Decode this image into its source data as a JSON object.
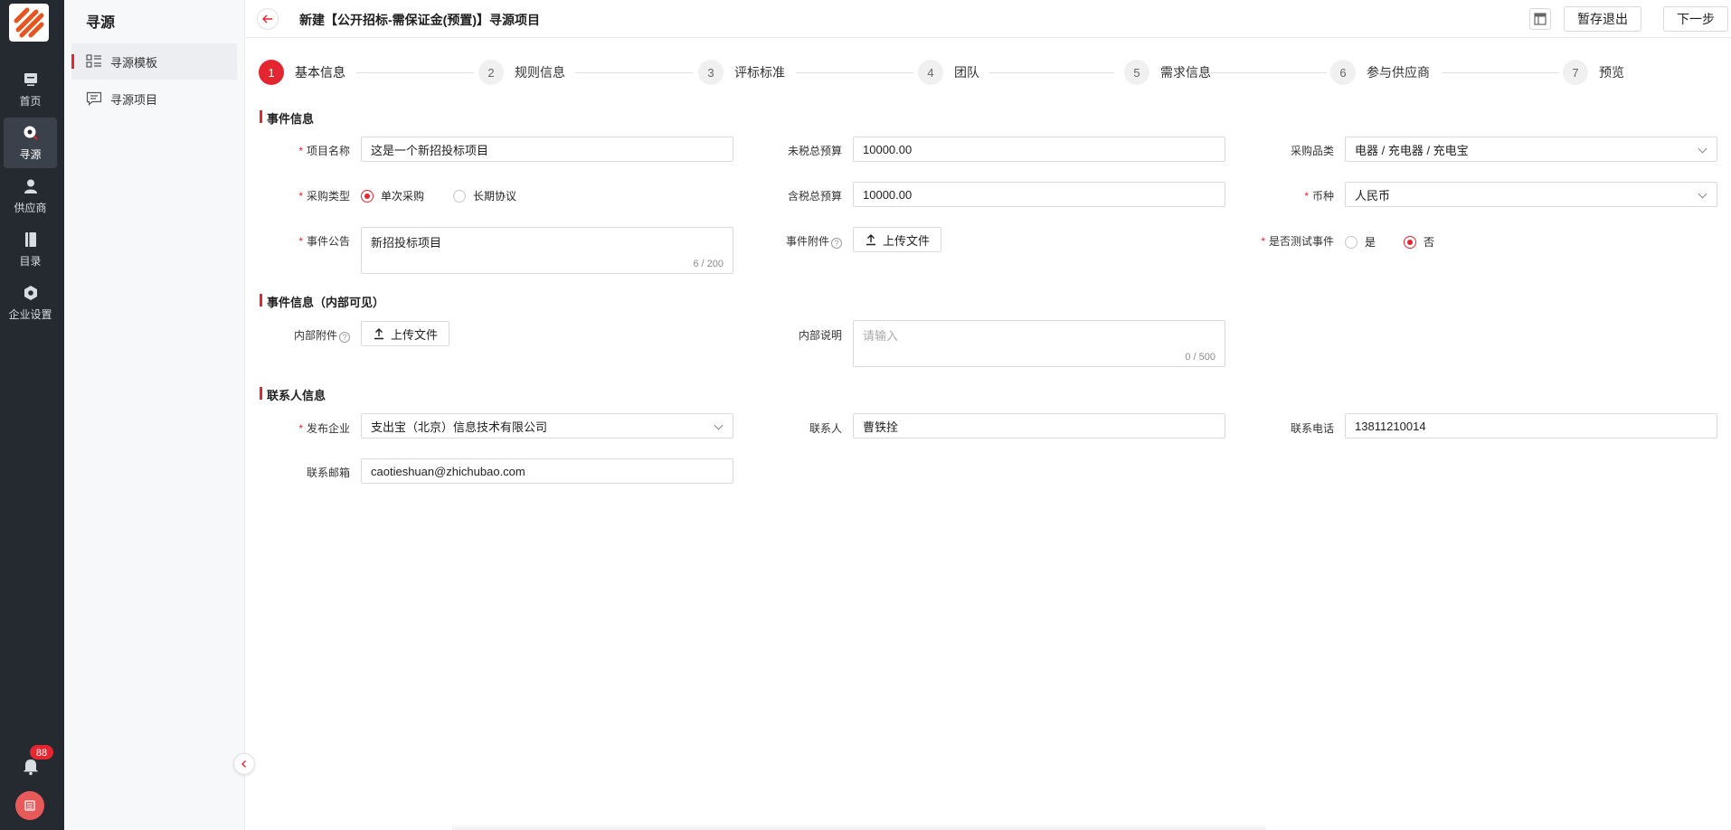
{
  "rail": {
    "items": [
      {
        "label": "首页",
        "icon": "home-icon"
      },
      {
        "label": "寻源",
        "icon": "sourcing-icon"
      },
      {
        "label": "供应商",
        "icon": "supplier-icon"
      },
      {
        "label": "目录",
        "icon": "catalog-icon"
      },
      {
        "label": "企业设置",
        "icon": "settings-icon"
      }
    ],
    "active": "寻源",
    "notification_count": "88"
  },
  "subnav": {
    "title": "寻源",
    "items": [
      {
        "label": "寻源模板",
        "icon": "template-icon"
      },
      {
        "label": "寻源项目",
        "icon": "project-icon"
      }
    ],
    "active": "寻源模板"
  },
  "header": {
    "title": "新建【公开招标-需保证金(预置)】寻源项目",
    "save_exit": "暂存退出",
    "next": "下一步"
  },
  "steps": [
    {
      "num": "1",
      "label": "基本信息"
    },
    {
      "num": "2",
      "label": "规则信息"
    },
    {
      "num": "3",
      "label": "评标标准"
    },
    {
      "num": "4",
      "label": "团队"
    },
    {
      "num": "5",
      "label": "需求信息"
    },
    {
      "num": "6",
      "label": "参与供应商"
    },
    {
      "num": "7",
      "label": "预览"
    }
  ],
  "sections": {
    "event_info": "事件信息",
    "internal_info": "事件信息（内部可见）",
    "contact_info": "联系人信息"
  },
  "form": {
    "project_name": {
      "label": "项目名称",
      "value": "这是一个新招投标项目"
    },
    "pretax_budget": {
      "label": "未税总预算",
      "value": "10000.00"
    },
    "category": {
      "label": "采购品类",
      "value": "电器 / 充电器 / 充电宝"
    },
    "purchase_type": {
      "label": "采购类型",
      "options": [
        "单次采购",
        "长期协议"
      ],
      "selected": "单次采购"
    },
    "tax_budget": {
      "label": "含税总预算",
      "value": "10000.00"
    },
    "currency": {
      "label": "币种",
      "value": "人民币"
    },
    "announcement": {
      "label": "事件公告",
      "value": "新招投标项目",
      "counter": "6 / 200"
    },
    "attachment": {
      "label": "事件附件",
      "button": "上传文件"
    },
    "is_test": {
      "label": "是否测试事件",
      "options": [
        "是",
        "否"
      ],
      "selected": "否"
    },
    "internal_attachment": {
      "label": "内部附件",
      "button": "上传文件"
    },
    "internal_note": {
      "label": "内部说明",
      "placeholder": "请输入",
      "counter": "0 / 500"
    },
    "company": {
      "label": "发布企业",
      "value": "支出宝（北京）信息技术有限公司"
    },
    "contact": {
      "label": "联系人",
      "value": "曹铁拴"
    },
    "phone": {
      "label": "联系电话",
      "value": "13811210014"
    },
    "email": {
      "label": "联系邮箱",
      "value": "caotieshuan@zhichubao.com"
    }
  },
  "colors": {
    "accent": "#e3262f",
    "rail_bg": "#252a31",
    "subnav_bg": "#f7f8fa"
  }
}
